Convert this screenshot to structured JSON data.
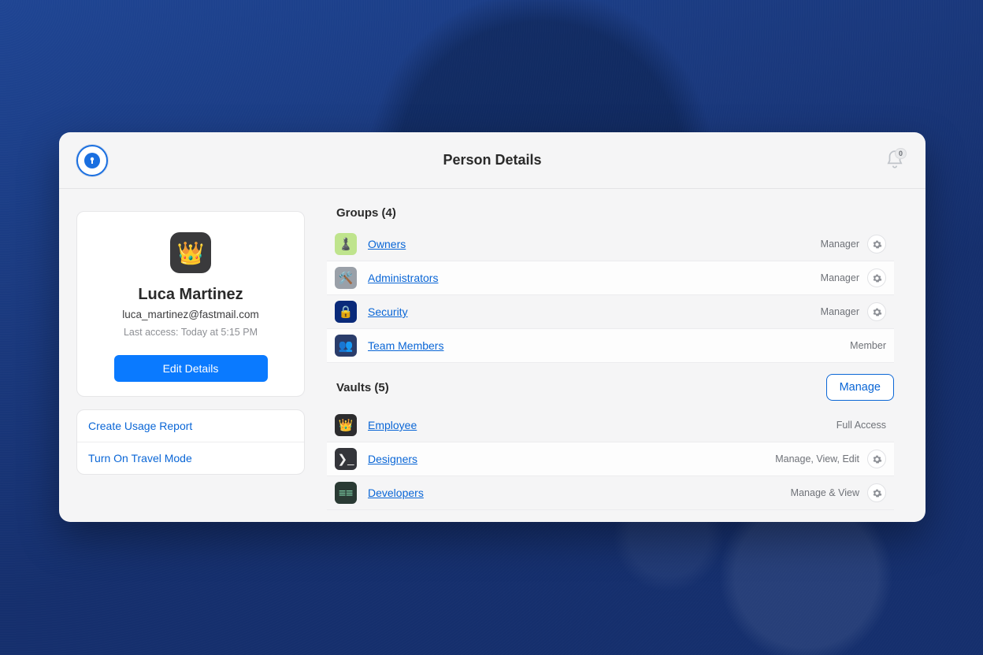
{
  "header": {
    "title": "Person Details",
    "notification_count": "0"
  },
  "person": {
    "avatar_icon": "crown-icon",
    "name": "Luca Martinez",
    "email": "luca_martinez@fastmail.com",
    "last_access": "Last access: Today at 5:15 PM",
    "edit_label": "Edit Details"
  },
  "actions": {
    "items": [
      {
        "label": "Create Usage Report"
      },
      {
        "label": "Turn On Travel Mode"
      }
    ]
  },
  "groups": {
    "title": "Groups (4)",
    "items": [
      {
        "icon": "chess-icon",
        "name": "Owners",
        "role": "Manager",
        "has_gear": true
      },
      {
        "icon": "tools-icon",
        "name": "Administrators",
        "role": "Manager",
        "has_gear": true
      },
      {
        "icon": "lock-icon",
        "name": "Security",
        "role": "Manager",
        "has_gear": true
      },
      {
        "icon": "people-icon",
        "name": "Team Members",
        "role": "Member",
        "has_gear": false
      }
    ]
  },
  "vaults": {
    "title": "Vaults (5)",
    "manage_label": "Manage",
    "items": [
      {
        "icon": "crown-icon",
        "name": "Employee",
        "role": "Full Access",
        "has_gear": false
      },
      {
        "icon": "terminal-icon",
        "name": "Designers",
        "role": "Manage, View, Edit",
        "has_gear": true
      },
      {
        "icon": "code-icon",
        "name": "Developers",
        "role": "Manage & View",
        "has_gear": true
      }
    ]
  }
}
